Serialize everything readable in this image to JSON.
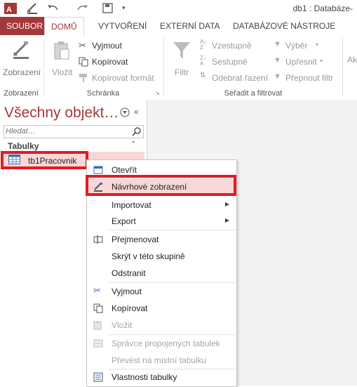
{
  "titlebar": {
    "title": "db1 : Databáze-",
    "save_icon": "save-icon",
    "undo_icon": "undo-icon",
    "redo_icon": "redo-icon"
  },
  "tabs": [
    "SOUBOR",
    "DOMŮ",
    "VYTVOŘENÍ",
    "EXTERNÍ DATA",
    "DATABÁZOVÉ NÁSTROJE"
  ],
  "ribbon": {
    "views_group": "Zobrazení",
    "views_btn": "Zobrazení",
    "clipboard_group": "Schránka",
    "paste": "Vložit",
    "cut": "Vyjmout",
    "copy": "Kopírovat",
    "format_painter": "Kopírovat formát",
    "sort_group": "Seřadit a filtrovat",
    "filter": "Filtr",
    "ascending": "Vzestupně",
    "descending": "Sestupně",
    "remove_sort": "Odebrat řazení",
    "selection": "Výběr",
    "advanced": "Upřesnit",
    "toggle_filter": "Přepnout filtr",
    "more": "Ak"
  },
  "nav": {
    "title": "Všechny objekt…",
    "search_placeholder": "Hledat…",
    "group": "Tabulky",
    "item": "tb1Pracovnik"
  },
  "menu": {
    "open": "Otevřít",
    "design": "Návrhové zobrazení",
    "import": "Importovat",
    "export": "Export",
    "rename": "Přejmenovat",
    "hide": "Skrýt v této skupině",
    "delete": "Odstranit",
    "cut": "Vyjmout",
    "copy": "Kopírovat",
    "paste": "Vložit",
    "linked": "Správce propojených tabulek",
    "convert": "Převést na místní tabulku",
    "props": "Vlastnosti tabulky"
  },
  "colors": {
    "accent": "#a4373a",
    "highlight": "#e21b23"
  }
}
